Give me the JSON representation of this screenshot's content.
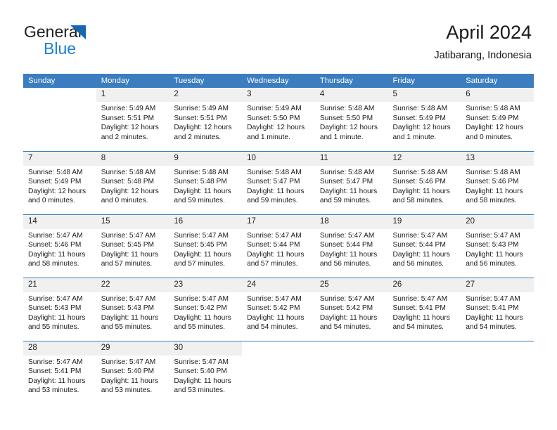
{
  "brand": {
    "name_top": "General",
    "name_bottom": "Blue",
    "triangle_color": "#1568b0",
    "blue_text_color": "#1a7fd4"
  },
  "header": {
    "title": "April 2024",
    "subtitle": "Jatibarang, Indonesia"
  },
  "theme": {
    "header_blue": "#3b7dbf",
    "daynum_band": "#f0f0f0",
    "text": "#1a1a1a"
  },
  "weekdays": [
    "Sunday",
    "Monday",
    "Tuesday",
    "Wednesday",
    "Thursday",
    "Friday",
    "Saturday"
  ],
  "labels": {
    "sunrise_prefix": "Sunrise:",
    "sunset_prefix": "Sunset:",
    "daylight_prefix": "Daylight:"
  },
  "weeks": [
    [
      {
        "day": "",
        "empty": true
      },
      {
        "day": "1",
        "sunrise": "Sunrise: 5:49 AM",
        "sunset": "Sunset: 5:51 PM",
        "daylight_line1": "Daylight: 12 hours",
        "daylight_line2": "and 2 minutes."
      },
      {
        "day": "2",
        "sunrise": "Sunrise: 5:49 AM",
        "sunset": "Sunset: 5:51 PM",
        "daylight_line1": "Daylight: 12 hours",
        "daylight_line2": "and 2 minutes."
      },
      {
        "day": "3",
        "sunrise": "Sunrise: 5:49 AM",
        "sunset": "Sunset: 5:50 PM",
        "daylight_line1": "Daylight: 12 hours",
        "daylight_line2": "and 1 minute."
      },
      {
        "day": "4",
        "sunrise": "Sunrise: 5:48 AM",
        "sunset": "Sunset: 5:50 PM",
        "daylight_line1": "Daylight: 12 hours",
        "daylight_line2": "and 1 minute."
      },
      {
        "day": "5",
        "sunrise": "Sunrise: 5:48 AM",
        "sunset": "Sunset: 5:49 PM",
        "daylight_line1": "Daylight: 12 hours",
        "daylight_line2": "and 1 minute."
      },
      {
        "day": "6",
        "sunrise": "Sunrise: 5:48 AM",
        "sunset": "Sunset: 5:49 PM",
        "daylight_line1": "Daylight: 12 hours",
        "daylight_line2": "and 0 minutes."
      }
    ],
    [
      {
        "day": "7",
        "sunrise": "Sunrise: 5:48 AM",
        "sunset": "Sunset: 5:49 PM",
        "daylight_line1": "Daylight: 12 hours",
        "daylight_line2": "and 0 minutes."
      },
      {
        "day": "8",
        "sunrise": "Sunrise: 5:48 AM",
        "sunset": "Sunset: 5:48 PM",
        "daylight_line1": "Daylight: 12 hours",
        "daylight_line2": "and 0 minutes."
      },
      {
        "day": "9",
        "sunrise": "Sunrise: 5:48 AM",
        "sunset": "Sunset: 5:48 PM",
        "daylight_line1": "Daylight: 11 hours",
        "daylight_line2": "and 59 minutes."
      },
      {
        "day": "10",
        "sunrise": "Sunrise: 5:48 AM",
        "sunset": "Sunset: 5:47 PM",
        "daylight_line1": "Daylight: 11 hours",
        "daylight_line2": "and 59 minutes."
      },
      {
        "day": "11",
        "sunrise": "Sunrise: 5:48 AM",
        "sunset": "Sunset: 5:47 PM",
        "daylight_line1": "Daylight: 11 hours",
        "daylight_line2": "and 59 minutes."
      },
      {
        "day": "12",
        "sunrise": "Sunrise: 5:48 AM",
        "sunset": "Sunset: 5:46 PM",
        "daylight_line1": "Daylight: 11 hours",
        "daylight_line2": "and 58 minutes."
      },
      {
        "day": "13",
        "sunrise": "Sunrise: 5:48 AM",
        "sunset": "Sunset: 5:46 PM",
        "daylight_line1": "Daylight: 11 hours",
        "daylight_line2": "and 58 minutes."
      }
    ],
    [
      {
        "day": "14",
        "sunrise": "Sunrise: 5:47 AM",
        "sunset": "Sunset: 5:46 PM",
        "daylight_line1": "Daylight: 11 hours",
        "daylight_line2": "and 58 minutes."
      },
      {
        "day": "15",
        "sunrise": "Sunrise: 5:47 AM",
        "sunset": "Sunset: 5:45 PM",
        "daylight_line1": "Daylight: 11 hours",
        "daylight_line2": "and 57 minutes."
      },
      {
        "day": "16",
        "sunrise": "Sunrise: 5:47 AM",
        "sunset": "Sunset: 5:45 PM",
        "daylight_line1": "Daylight: 11 hours",
        "daylight_line2": "and 57 minutes."
      },
      {
        "day": "17",
        "sunrise": "Sunrise: 5:47 AM",
        "sunset": "Sunset: 5:44 PM",
        "daylight_line1": "Daylight: 11 hours",
        "daylight_line2": "and 57 minutes."
      },
      {
        "day": "18",
        "sunrise": "Sunrise: 5:47 AM",
        "sunset": "Sunset: 5:44 PM",
        "daylight_line1": "Daylight: 11 hours",
        "daylight_line2": "and 56 minutes."
      },
      {
        "day": "19",
        "sunrise": "Sunrise: 5:47 AM",
        "sunset": "Sunset: 5:44 PM",
        "daylight_line1": "Daylight: 11 hours",
        "daylight_line2": "and 56 minutes."
      },
      {
        "day": "20",
        "sunrise": "Sunrise: 5:47 AM",
        "sunset": "Sunset: 5:43 PM",
        "daylight_line1": "Daylight: 11 hours",
        "daylight_line2": "and 56 minutes."
      }
    ],
    [
      {
        "day": "21",
        "sunrise": "Sunrise: 5:47 AM",
        "sunset": "Sunset: 5:43 PM",
        "daylight_line1": "Daylight: 11 hours",
        "daylight_line2": "and 55 minutes."
      },
      {
        "day": "22",
        "sunrise": "Sunrise: 5:47 AM",
        "sunset": "Sunset: 5:43 PM",
        "daylight_line1": "Daylight: 11 hours",
        "daylight_line2": "and 55 minutes."
      },
      {
        "day": "23",
        "sunrise": "Sunrise: 5:47 AM",
        "sunset": "Sunset: 5:42 PM",
        "daylight_line1": "Daylight: 11 hours",
        "daylight_line2": "and 55 minutes."
      },
      {
        "day": "24",
        "sunrise": "Sunrise: 5:47 AM",
        "sunset": "Sunset: 5:42 PM",
        "daylight_line1": "Daylight: 11 hours",
        "daylight_line2": "and 54 minutes."
      },
      {
        "day": "25",
        "sunrise": "Sunrise: 5:47 AM",
        "sunset": "Sunset: 5:42 PM",
        "daylight_line1": "Daylight: 11 hours",
        "daylight_line2": "and 54 minutes."
      },
      {
        "day": "26",
        "sunrise": "Sunrise: 5:47 AM",
        "sunset": "Sunset: 5:41 PM",
        "daylight_line1": "Daylight: 11 hours",
        "daylight_line2": "and 54 minutes."
      },
      {
        "day": "27",
        "sunrise": "Sunrise: 5:47 AM",
        "sunset": "Sunset: 5:41 PM",
        "daylight_line1": "Daylight: 11 hours",
        "daylight_line2": "and 54 minutes."
      }
    ],
    [
      {
        "day": "28",
        "sunrise": "Sunrise: 5:47 AM",
        "sunset": "Sunset: 5:41 PM",
        "daylight_line1": "Daylight: 11 hours",
        "daylight_line2": "and 53 minutes."
      },
      {
        "day": "29",
        "sunrise": "Sunrise: 5:47 AM",
        "sunset": "Sunset: 5:40 PM",
        "daylight_line1": "Daylight: 11 hours",
        "daylight_line2": "and 53 minutes."
      },
      {
        "day": "30",
        "sunrise": "Sunrise: 5:47 AM",
        "sunset": "Sunset: 5:40 PM",
        "daylight_line1": "Daylight: 11 hours",
        "daylight_line2": "and 53 minutes."
      },
      {
        "day": "",
        "empty": true
      },
      {
        "day": "",
        "empty": true
      },
      {
        "day": "",
        "empty": true
      },
      {
        "day": "",
        "empty": true
      }
    ]
  ]
}
